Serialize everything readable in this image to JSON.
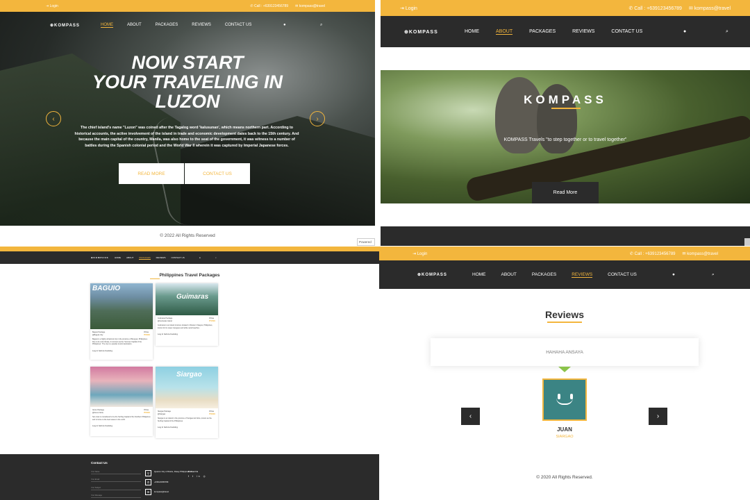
{
  "panel1": {
    "topbar": {
      "login": "Login",
      "call": "Call : +639123456789",
      "email": "kompass@travel"
    },
    "logo": "KOMPASS",
    "nav": [
      "HOME",
      "ABOUT",
      "PACKAGES",
      "REVIEWS",
      "CONTACT US"
    ],
    "hero_title_line1": "NOW START",
    "hero_title_line2": "YOUR TRAVELING IN",
    "hero_title_line3": "LUZON",
    "hero_desc": "The chief island's name \"Luzon\" was coined after the Tagalog word 'kalusunan', which means northern part. According to historical accounts, the active involvement of the island in trade and economic development dates back to the 15th century. And because the main capital of the country, Manila, was also home to the seat of the government, it was witness to a number of battles during the Spanish colonial period and the World War II wherein it was captured by Imperial Japanese forces.",
    "btn_read_more": "READ MORE",
    "btn_contact": "CONTACT US",
    "footer": "© 2022 All Rights Reserved",
    "powered": "Powered"
  },
  "panel2": {
    "topbar": {
      "login": "Login",
      "call": "Call : +639123456789",
      "email": "kompass@travel"
    },
    "logo": "KOMPASS",
    "nav": [
      "HOME",
      "ABOUT",
      "PACKAGES",
      "REVIEWS",
      "CONTACT US"
    ],
    "hero_title": "KOMPASS",
    "tagline": "KOMPASS Travels \"to step together or to travel together\"",
    "btn_read_more": "Read More"
  },
  "panel3": {
    "nav": [
      "HOME",
      "ABOUT",
      "PACKAGES",
      "REVIEWS",
      "CONTACT US"
    ],
    "logo": "KOMPASS",
    "section_title": "Philippines Travel Packages",
    "cards": [
      {
        "img_text": "BAGUIO",
        "name": "Baguio Package",
        "sub": "@Baguio City",
        "price_label": "Price",
        "price": "₱2000",
        "desc": "Baguio is a highly urbanized city in the province of Benguet, Philippines. Due to its cool climate, it is known as the 'Summer Capital of the Philippines'. The city is a popular tourist destination.",
        "login": "Log in before booking"
      },
      {
        "img_text": "Guimaras",
        "name": "Guimaras Package",
        "sub": "@Guimaras Island",
        "price_label": "Price",
        "price": "₱1500",
        "desc": "Guimaras is an island province located in Western Visayas, Philippines, known for its sweet mangoes and white sand beaches.",
        "login": "Log in before booking"
      },
      {
        "img_text": "",
        "name": "Ilocos Package",
        "sub": "@Ilocos Norte",
        "price_label": "Price",
        "price": "₱2000",
        "desc": "San Juan is considered to be the Surfing Capital of the Northern Philippines and is home to the best waves in the north.",
        "login": "Log in before booking"
      },
      {
        "img_text": "Siargao",
        "name": "Siargao Package",
        "sub": "@Siargao",
        "price_label": "Price",
        "price": "₱3000",
        "desc": "Siargao is an island in the province of Surigao del Norte, known as the Surfing Capital of the Philippines.",
        "login": "Log in before booking"
      }
    ],
    "footer": {
      "contact_title": "Contact Us",
      "fields": [
        "Your Name",
        "Your Email",
        "Your Subject",
        "Your Message"
      ],
      "address": "Quezon City of Works, Pasay Philippines",
      "phone": "+639123456789",
      "email": "kompass@travel",
      "follow": "Follow Us",
      "socials": "f t in ◎"
    }
  },
  "panel4": {
    "topbar": {
      "login": "Login",
      "call": "Call : +639123456789",
      "email": "kompass@travel"
    },
    "logo": "KOMPASS",
    "nav": [
      "HOME",
      "ABOUT",
      "PACKAGES",
      "REVIEWS",
      "CONTACT US"
    ],
    "title": "Reviews",
    "quote": "HAHAHA ANSAYA",
    "name": "JUAN",
    "location": "SIARGAO",
    "footer": "© 2020 All Rights Reserved."
  },
  "colors": {
    "accent": "#f3b63d",
    "dark": "#2b2b2b",
    "avatar": "#3b8484"
  }
}
